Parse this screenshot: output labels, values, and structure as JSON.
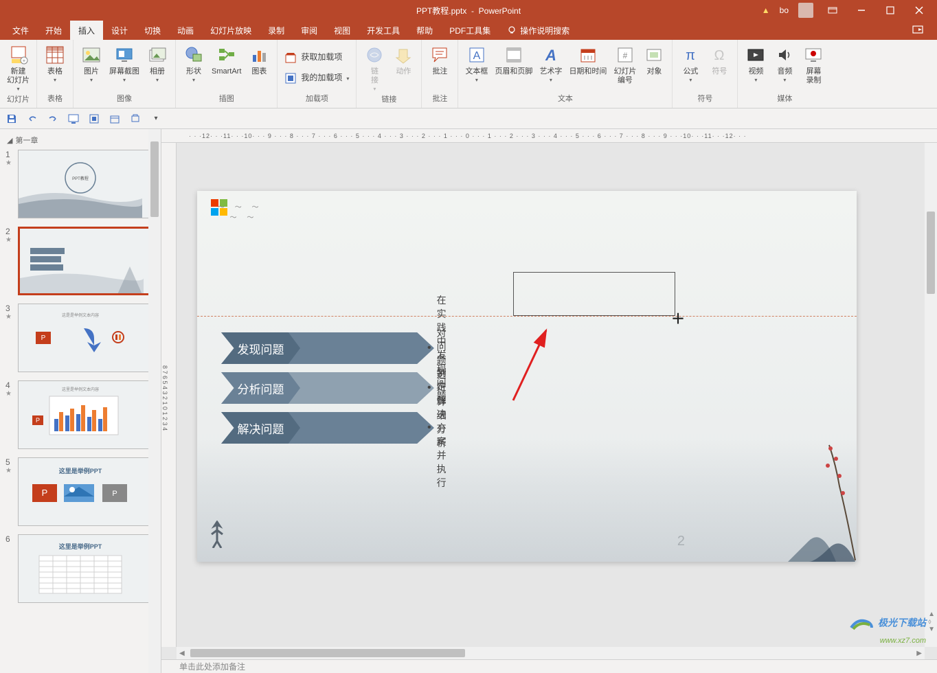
{
  "title": {
    "filename": "PPT教程.pptx",
    "app": "PowerPoint",
    "user": "bo"
  },
  "menu": {
    "file": "文件",
    "home": "开始",
    "insert": "插入",
    "design": "设计",
    "transitions": "切换",
    "animations": "动画",
    "slideshow": "幻灯片放映",
    "recording": "录制",
    "review": "审阅",
    "view": "视图",
    "developer": "开发工具",
    "help": "帮助",
    "pdftools": "PDF工具集",
    "tellme": "操作说明搜索"
  },
  "ribbon": {
    "groups": {
      "slides": {
        "label": "幻灯片",
        "newSlide": "新建\n幻灯片"
      },
      "tables": {
        "label": "表格",
        "table": "表格"
      },
      "images": {
        "label": "图像",
        "picture": "图片",
        "screenshot": "屏幕截图",
        "album": "相册"
      },
      "illustrations": {
        "label": "插图",
        "shapes": "形状",
        "smartart": "SmartArt",
        "chart": "图表"
      },
      "addins": {
        "label": "加载项",
        "get": "获取加载项",
        "my": "我的加载项"
      },
      "links": {
        "label": "链接",
        "link": "链\n接",
        "action": "动作"
      },
      "comments": {
        "label": "批注",
        "comment": "批注"
      },
      "text": {
        "label": "文本",
        "textbox": "文本框",
        "headerfooter": "页眉和页脚",
        "wordart": "艺术字",
        "datetime": "日期和时间",
        "slidenum": "幻灯片\n编号",
        "object": "对象"
      },
      "symbols": {
        "label": "符号",
        "equation": "公式",
        "symbol": "符号"
      },
      "media": {
        "label": "媒体",
        "video": "视频",
        "audio": "音频",
        "screenrec": "屏幕\n录制"
      }
    }
  },
  "thumbnails": {
    "section": "第一章",
    "slides": [
      {
        "num": "1"
      },
      {
        "num": "2",
        "selected": true
      },
      {
        "num": "3"
      },
      {
        "num": "4"
      },
      {
        "num": "5",
        "title": "这里是举例PPT"
      },
      {
        "num": "6",
        "title": "这里是举例PPT"
      }
    ]
  },
  "slide": {
    "items": [
      {
        "head": "发现问题",
        "body": "在实践中发现问题"
      },
      {
        "head": "分析问题",
        "body": "对问题进行详细分析"
      },
      {
        "head": "解决问题",
        "body": "制定解决方案并执行"
      }
    ],
    "pageNum": "2"
  },
  "ruler": {
    "h": "· · ·12· · ·11· · ·10· · · 9 · · · 8 · · · 7 · · · 6 · · · 5 · · · 4 · · · 3 · · · 2 · · · 1 · · · 0 · · · 1 · · · 2 · · · 3 · · · 4 · · · 5 · · · 6 · · · 7 · · · 8 · · · 9 · · ·10· · ·11· · ·12· · ·",
    "v": "8  7  6  5  4  3  2  1  0  1  2  3  4"
  },
  "notes": "单击此处添加备注",
  "watermark": {
    "line1": "极光下载站",
    "line2": "www.xz7.com"
  }
}
